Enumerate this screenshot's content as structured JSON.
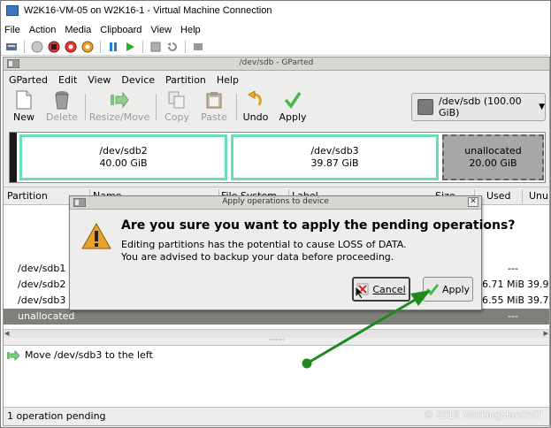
{
  "window": {
    "title": "W2K16-VM-05 on W2K16-1 - Virtual Machine Connection",
    "menu": [
      "File",
      "Action",
      "Media",
      "Clipboard",
      "View",
      "Help"
    ]
  },
  "gparted": {
    "title": "/dev/sdb - GParted",
    "menu": [
      "GParted",
      "Edit",
      "View",
      "Device",
      "Partition",
      "Help"
    ],
    "toolbar": {
      "new": "New",
      "delete": "Delete",
      "resize_move": "Resize/Move",
      "copy": "Copy",
      "paste": "Paste",
      "undo": "Undo",
      "apply": "Apply"
    },
    "device": {
      "label": "/dev/sdb  (100.00 GiB)"
    },
    "map": [
      {
        "name": "/dev/sdb2",
        "size": "40.00 GiB"
      },
      {
        "name": "/dev/sdb3",
        "size": "39.87 GiB"
      },
      {
        "name": "unallocated",
        "size": "20.00 GiB"
      }
    ],
    "columns": {
      "partition": "Partition",
      "name": "Name",
      "file_system": "File System",
      "label": "Label",
      "size": "Size",
      "used": "Used",
      "unused": "Unu"
    },
    "rows": [
      {
        "partition": "/dev/sdb1",
        "used": "---",
        "unused": ""
      },
      {
        "partition": "/dev/sdb2",
        "used": "6.71 MiB",
        "unused": "39.9"
      },
      {
        "partition": "/dev/sdb3",
        "used": "6.55 MiB",
        "unused": "39.7"
      },
      {
        "partition": "unallocated",
        "used": "---",
        "unused": ""
      }
    ],
    "pending": {
      "operation": "Move /dev/sdb3 to the left"
    },
    "status": "1 operation pending",
    "copyright": "© 2016 WorkingHardInIT"
  },
  "dialog": {
    "title": "Apply operations to device",
    "heading": "Are you sure you want to apply the pending operations?",
    "body_line1": "Editing partitions has the potential to cause LOSS of DATA.",
    "body_line2": "You are advised to backup your data before proceeding.",
    "cancel": "Cancel",
    "apply": "Apply"
  },
  "colors": {
    "partition_border": "#68e0b2",
    "unallocated_fill": "#a8a8a8",
    "selected_row": "#7f7f7c",
    "annotation_arrow": "#1e8a1e"
  }
}
